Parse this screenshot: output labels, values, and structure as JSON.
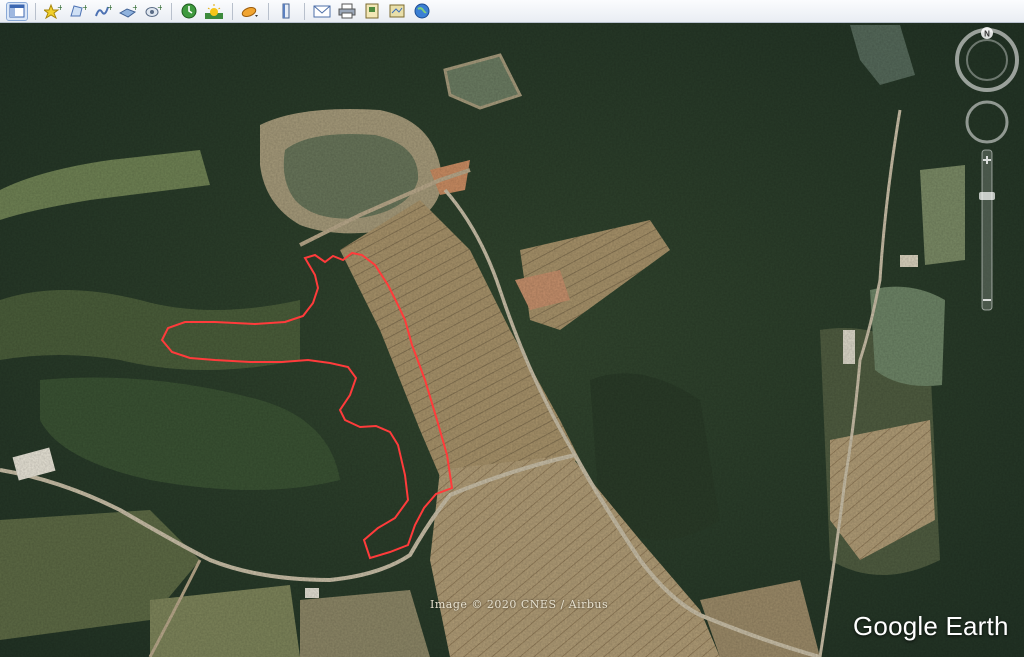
{
  "toolbar": {
    "buttons": [
      {
        "icon": "sidebar-toggle-icon"
      },
      {
        "icon": "add-placemark-icon"
      },
      {
        "icon": "add-polygon-icon"
      },
      {
        "icon": "add-path-icon"
      },
      {
        "icon": "add-image-overlay-icon"
      },
      {
        "icon": "record-tour-icon"
      },
      {
        "icon": "historical-imagery-icon"
      },
      {
        "icon": "sunlight-icon"
      },
      {
        "icon": "switch-to-sky-icon"
      },
      {
        "icon": "ruler-icon"
      },
      {
        "icon": "email-icon"
      },
      {
        "icon": "print-icon"
      },
      {
        "icon": "save-image-icon"
      },
      {
        "icon": "view-in-maps-icon"
      },
      {
        "icon": "earth-gallery-icon"
      }
    ]
  },
  "compass": {
    "north_label": "N"
  },
  "colors": {
    "polygon_outline": "#ff3b3b",
    "forest": "#2c3f2c",
    "field": "#9a8a66",
    "water": "#6c7d62",
    "road": "#c9bda4"
  },
  "attribution": "Image © 2020 CNES / Airbus",
  "brand": "Google Earth"
}
